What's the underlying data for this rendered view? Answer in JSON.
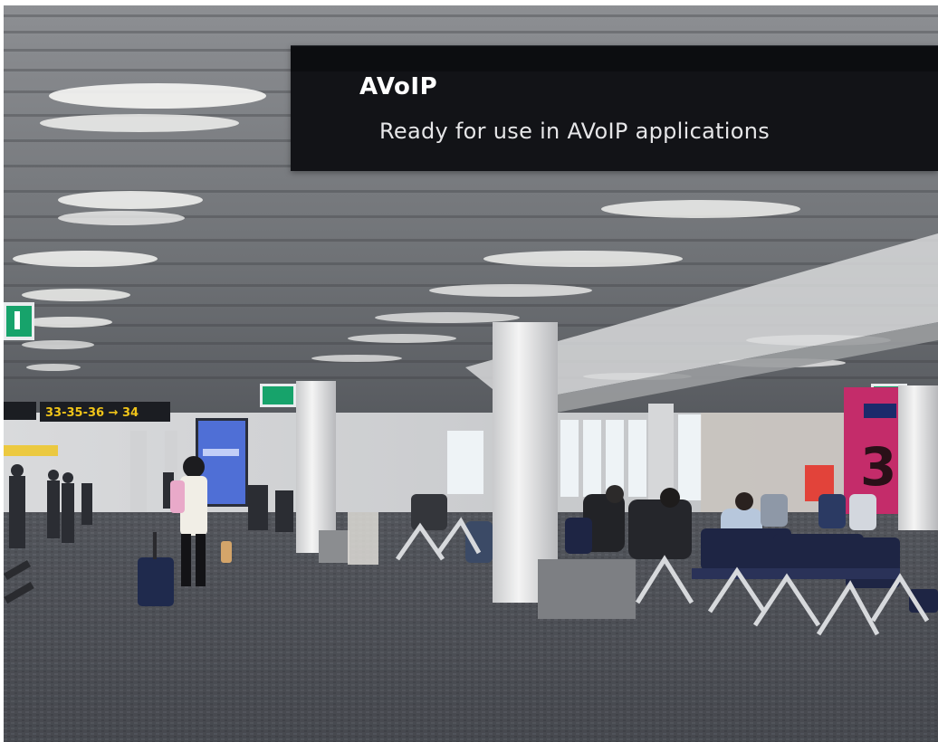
{
  "banner": {
    "title": "AVoIP",
    "subtitle": "Ready for use in AVoIP applications"
  },
  "scene": {
    "gate_sign": "33-35-36 → 34",
    "gate_number": "3"
  },
  "colors": {
    "banner_bg": "#121317",
    "banner_text": "#ffffff",
    "sign_yellow": "#f0c419",
    "exit_green": "#17a36b",
    "gate_pink": "#c42c6a",
    "seat_navy": "#1e2544"
  }
}
